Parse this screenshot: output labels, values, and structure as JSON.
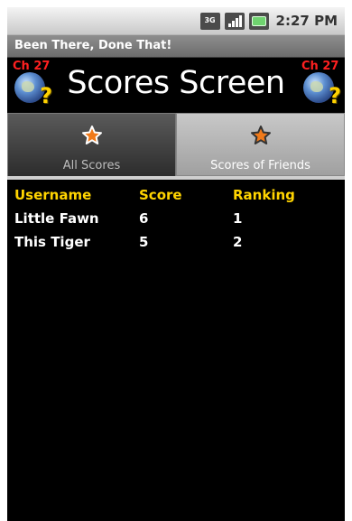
{
  "status_bar": {
    "network_label": "3G",
    "time": "2:27 PM"
  },
  "app": {
    "title": "Been There, Done That!"
  },
  "header": {
    "title": "Scores Screen",
    "badge": "Ch 27",
    "question_mark": "?"
  },
  "tabs": [
    {
      "label": "All Scores",
      "selected": true,
      "icon": "star-icon"
    },
    {
      "label": "Scores of Friends",
      "selected": false,
      "icon": "star-icon"
    }
  ],
  "table": {
    "columns": [
      "Username",
      "Score",
      "Ranking"
    ],
    "rows": [
      [
        "Little Fawn",
        "6",
        "1"
      ],
      [
        "This Tiger",
        "5",
        "2"
      ]
    ]
  },
  "colors": {
    "accent": "#ffd400",
    "background": "#000000",
    "star": "#f07a1a"
  }
}
